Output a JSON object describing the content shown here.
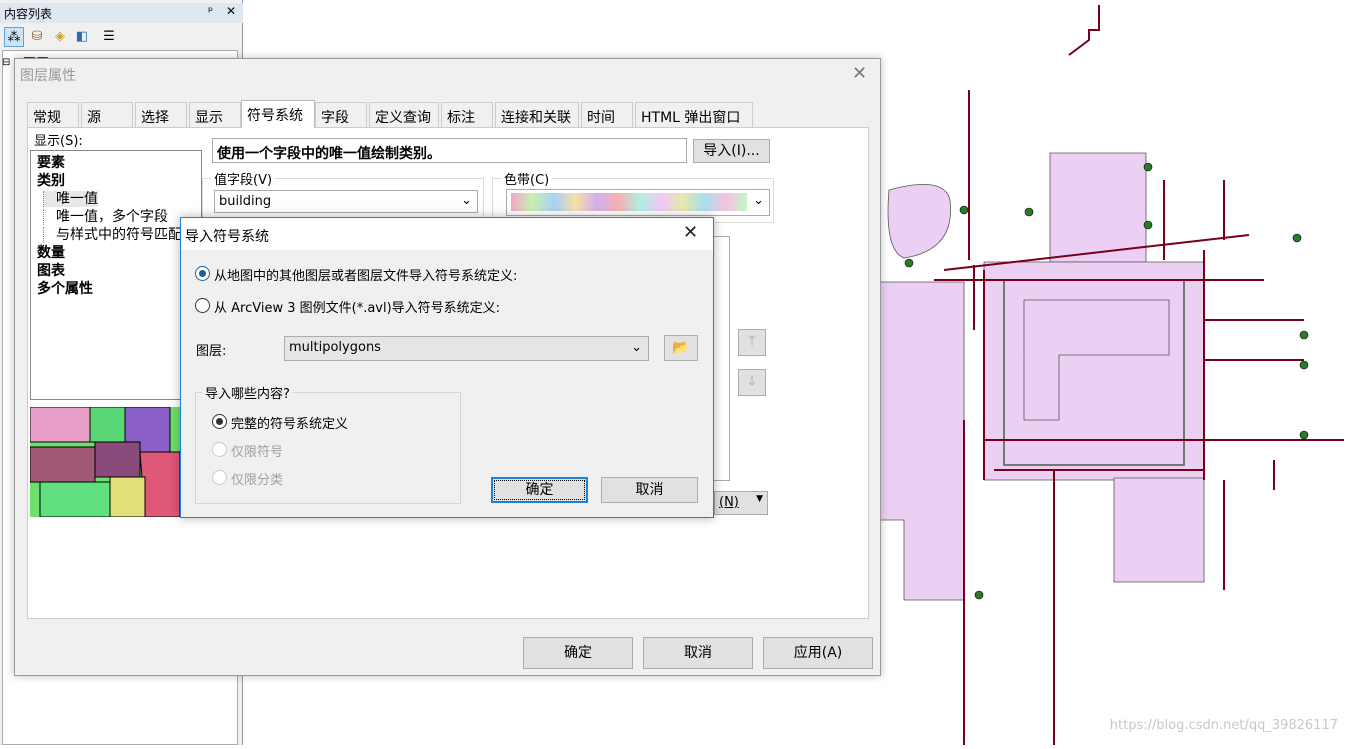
{
  "toc": {
    "title": "内容列表",
    "pin": "ᵖ",
    "close": "✕",
    "root_label": "图层",
    "tools": [
      "list-by-drawing-order",
      "list-by-source",
      "list-by-visibility",
      "list-by-selection",
      "options"
    ]
  },
  "dialog": {
    "title": "图层属性",
    "tabs": [
      "常规",
      "源",
      "选择",
      "显示",
      "符号系统",
      "字段",
      "定义查询",
      "标注",
      "连接和关联",
      "时间",
      "HTML 弹出窗口"
    ],
    "selected_tab": "符号系统",
    "show_label": "显示(S):",
    "show_items": [
      {
        "label": "要素",
        "bold": true
      },
      {
        "label": "类别",
        "bold": true
      },
      {
        "label": "唯一值",
        "bold": false,
        "selected": true
      },
      {
        "label": "唯一值，多个字段",
        "bold": false
      },
      {
        "label": "与样式中的符号匹配",
        "bold": false
      },
      {
        "label": "数量",
        "bold": true
      },
      {
        "label": "图表",
        "bold": true
      },
      {
        "label": "多个属性",
        "bold": true
      }
    ],
    "heading": "使用一个字段中的唯一值绘制类别。",
    "import_button": "导入(I)...",
    "value_field_label": "值字段(V)",
    "value_field": "building",
    "color_ramp_label": "色带(C)",
    "partial_combo": "(N)",
    "ok": "确定",
    "cancel": "取消",
    "apply": "应用(A)"
  },
  "import_dialog": {
    "title": "导入符号系统",
    "close": "✕",
    "option_map": "从地图中的其他图层或者图层文件导入符号系统定义:",
    "option_avl": "从 ArcView 3 图例文件(*.avl)导入符号系统定义:",
    "selected_option": "map",
    "layer_label": "图层:",
    "layer_value": "multipolygons",
    "what_label": "导入哪些内容?",
    "what_options": [
      {
        "label": "完整的符号系统定义",
        "checked": true,
        "enabled": true
      },
      {
        "label": "仅限符号",
        "checked": false,
        "enabled": false
      },
      {
        "label": "仅限分类",
        "checked": false,
        "enabled": false
      }
    ],
    "ok": "确定",
    "cancel": "取消"
  },
  "watermark": "https://blog.csdn.net/qq_39826117",
  "colors": {
    "polygon_fill": "#ebd0f3",
    "road": "#7a0019",
    "accent": "#1883d7"
  }
}
